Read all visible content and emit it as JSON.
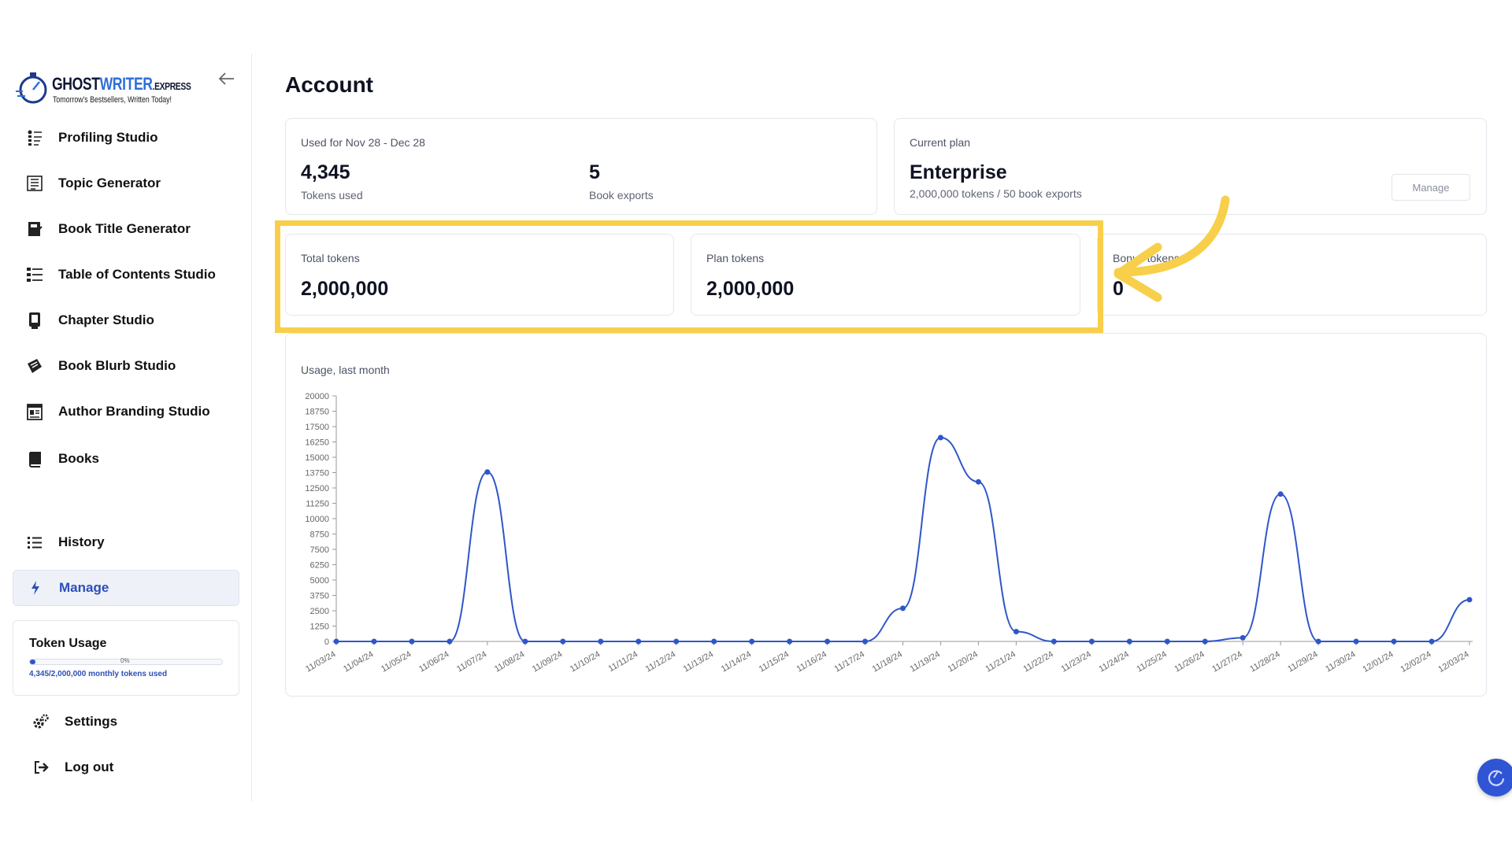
{
  "logo": {
    "brand_main": "GHOST",
    "brand_accent": "WRITER",
    "brand_suffix": ".EXPRESS",
    "tagline": "Tomorrow's Bestsellers, Written Today!"
  },
  "sidebar": {
    "items": [
      {
        "label": "Profiling Studio",
        "icon": "profiling-icon"
      },
      {
        "label": "Topic Generator",
        "icon": "topic-icon"
      },
      {
        "label": "Book Title Generator",
        "icon": "book-title-icon"
      },
      {
        "label": "Table of Contents Studio",
        "icon": "toc-icon"
      },
      {
        "label": "Chapter Studio",
        "icon": "chapter-icon"
      },
      {
        "label": "Book Blurb Studio",
        "icon": "blurb-icon"
      },
      {
        "label": "Author Branding Studio",
        "icon": "branding-icon"
      },
      {
        "label": "Books",
        "icon": "book-icon"
      }
    ],
    "history_label": "History",
    "manage_label": "Manage",
    "settings_label": "Settings",
    "logout_label": "Log out",
    "token_usage": {
      "title": "Token Usage",
      "percent_label": "0%",
      "used_fraction": 0.0022,
      "summary": "4,345/2,000,000 monthly tokens used"
    }
  },
  "main": {
    "title": "Account",
    "usage_card": {
      "period": "Used for Nov 28 - Dec 28",
      "tokens_value": "4,345",
      "tokens_label": "Tokens used",
      "exports_value": "5",
      "exports_label": "Book exports"
    },
    "plan_card": {
      "label": "Current plan",
      "plan_name": "Enterprise",
      "plan_detail": "2,000,000 tokens / 50 book exports",
      "manage_button": "Manage"
    },
    "total_tokens": {
      "label": "Total tokens",
      "value": "2,000,000"
    },
    "plan_tokens": {
      "label": "Plan tokens",
      "value": "2,000,000"
    },
    "bonus_tokens": {
      "label": "Bonus tokens",
      "value": "0"
    },
    "chart_title": "Usage, last month"
  },
  "colors": {
    "accent": "#2f56c9",
    "highlight": "#f8cf4a"
  },
  "chart_data": {
    "type": "line",
    "title": "Usage, last month",
    "ylim": [
      0,
      20000
    ],
    "yticks": [
      0,
      1250,
      2500,
      3750,
      5000,
      6250,
      7500,
      8750,
      10000,
      11250,
      12500,
      13750,
      15000,
      16250,
      17500,
      18750,
      20000
    ],
    "x": [
      "11/03/24",
      "11/04/24",
      "11/05/24",
      "11/06/24",
      "11/07/24",
      "11/08/24",
      "11/09/24",
      "11/10/24",
      "11/11/24",
      "11/12/24",
      "11/13/24",
      "11/14/24",
      "11/15/24",
      "11/16/24",
      "11/17/24",
      "11/18/24",
      "11/19/24",
      "11/20/24",
      "11/21/24",
      "11/22/24",
      "11/23/24",
      "11/24/24",
      "11/25/24",
      "11/26/24",
      "11/27/24",
      "11/28/24",
      "11/29/24",
      "11/30/24",
      "12/01/24",
      "12/02/24",
      "12/03/24"
    ],
    "series": [
      {
        "values": [
          0,
          0,
          0,
          0,
          13800,
          0,
          0,
          0,
          0,
          0,
          0,
          0,
          0,
          0,
          0,
          2700,
          16600,
          13000,
          800,
          0,
          0,
          0,
          0,
          0,
          300,
          12000,
          0,
          0,
          0,
          0,
          3400
        ]
      }
    ]
  }
}
